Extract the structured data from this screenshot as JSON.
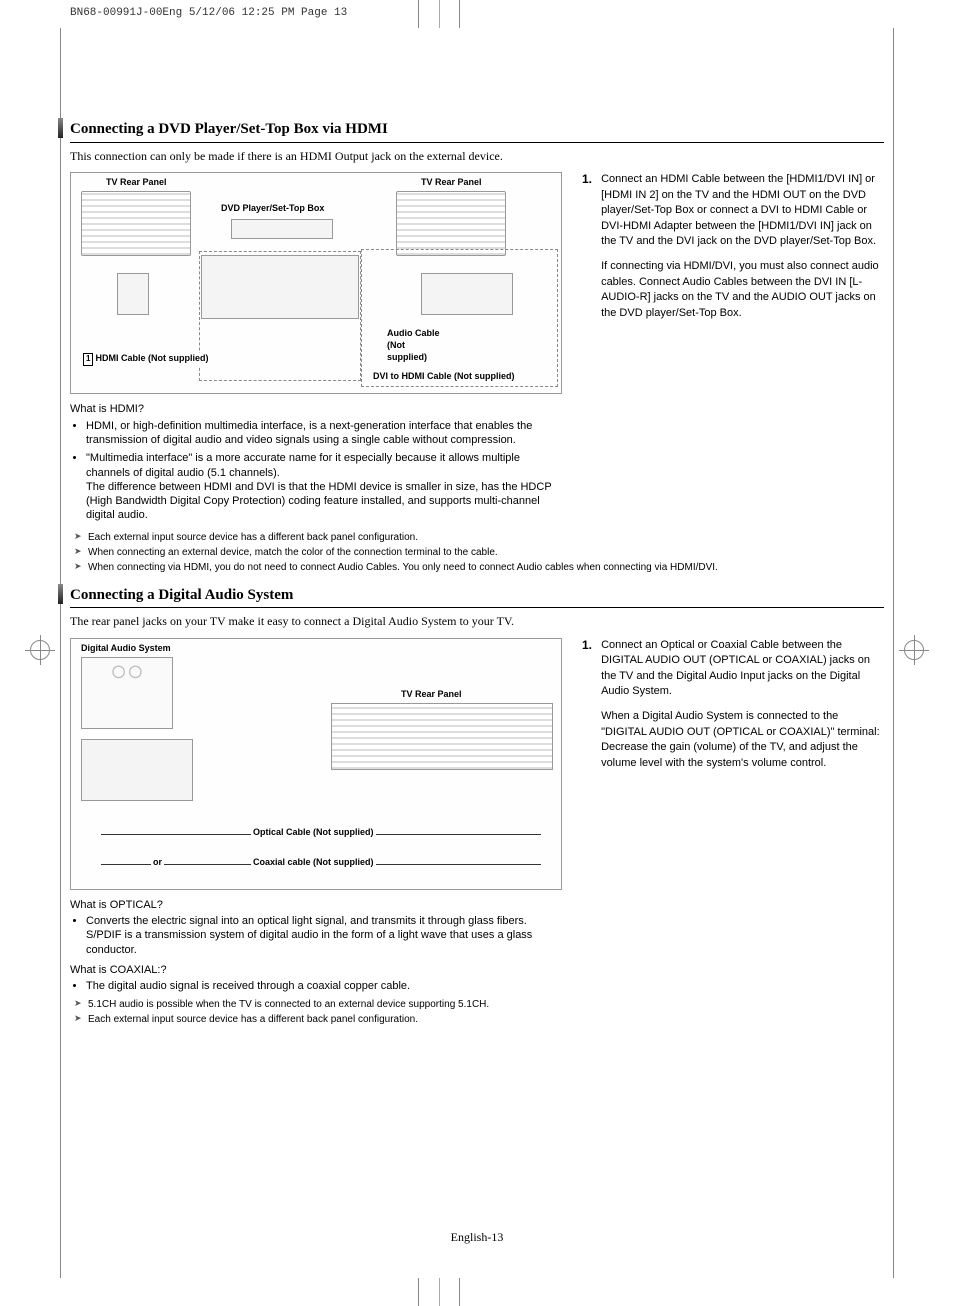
{
  "header": "BN68-00991J-00Eng  5/12/06  12:25 PM  Page 13",
  "section1": {
    "title": "Connecting a DVD Player/Set-Top Box via HDMI",
    "intro": "This connection can only be made if there is an HDMI Output jack on the external device.",
    "diagram": {
      "tv_panel_1": "TV Rear Panel",
      "tv_panel_2": "TV Rear Panel",
      "device": "DVD Player/Set-Top Box",
      "hdmi_cable_num": "1",
      "hdmi_cable": "HDMI Cable (Not supplied)",
      "audio_cable": "Audio Cable\n(Not supplied)",
      "dvi_cable": "DVI to HDMI Cable (Not supplied)"
    },
    "step_num": "1.",
    "step_text_1": "Connect an HDMI Cable between the [HDMI1/DVI IN] or [HDMI IN 2] on the TV and the HDMI OUT on the DVD player/Set-Top Box or connect a DVI to HDMI Cable or DVI-HDMI Adapter between the [HDMI1/DVI IN] jack on the TV and the DVI jack on the DVD player/Set-Top Box.",
    "step_text_2": "If connecting via HDMI/DVI, you must also connect audio cables. Connect Audio Cables between the DVI IN [L-AUDIO-R] jacks on the TV and the AUDIO OUT jacks on the DVD player/Set-Top Box.",
    "q1": "What is HDMI?",
    "a1_1": "HDMI, or high-definition multimedia interface, is a next-generation interface that enables the transmission of digital audio and video signals using a single cable without compression.",
    "a1_2": "\"Multimedia interface\" is a more accurate name for it especially because it allows multiple channels of digital audio (5.1 channels).\nThe difference between HDMI and DVI is that the HDMI device is smaller in size, has the HDCP (High Bandwidth Digital Copy Protection) coding feature installed, and supports multi-channel digital audio.",
    "notes": [
      "Each external input source device has a different back panel configuration.",
      "When connecting an external device, match the color of the connection terminal to the cable.",
      "When connecting via HDMI, you do not need to connect Audio Cables. You only need to connect Audio cables when connecting via HDMI/DVI."
    ]
  },
  "section2": {
    "title": "Connecting a Digital Audio System",
    "intro": "The rear panel jacks on your TV make it easy to connect a Digital Audio System to your TV.",
    "diagram": {
      "audio_system": "Digital Audio System",
      "tv_panel": "TV Rear Panel",
      "optical": "Optical Cable (Not supplied)",
      "or": "or",
      "coax": "Coaxial cable (Not supplied)"
    },
    "step_num": "1.",
    "step_text_1": "Connect an Optical or Coaxial Cable between the DIGITAL  AUDIO OUT (OPTICAL or COAXIAL) jacks on the TV and the Digital Audio Input jacks on the Digital Audio System.",
    "step_text_2": "When a Digital Audio System is connected to the \"DIGITAL AUDIO OUT (OPTICAL or COAXIAL)\" terminal:\nDecrease the gain (volume) of the TV, and adjust the volume level with the system's volume control.",
    "q1": "What is OPTICAL?",
    "a1": "Converts the electric signal into an optical light signal, and transmits it through glass fibers. S/PDIF is a transmission system of digital audio in the form of a light wave that uses a glass conductor.",
    "q2": "What is COAXIAL:?",
    "a2": "The digital audio signal is received through a coaxial copper cable.",
    "notes": [
      "5.1CH audio is possible when the TV is connected to an external device supporting 5.1CH.",
      "Each external input source device has a different back panel configuration."
    ]
  },
  "footer": "English-13"
}
